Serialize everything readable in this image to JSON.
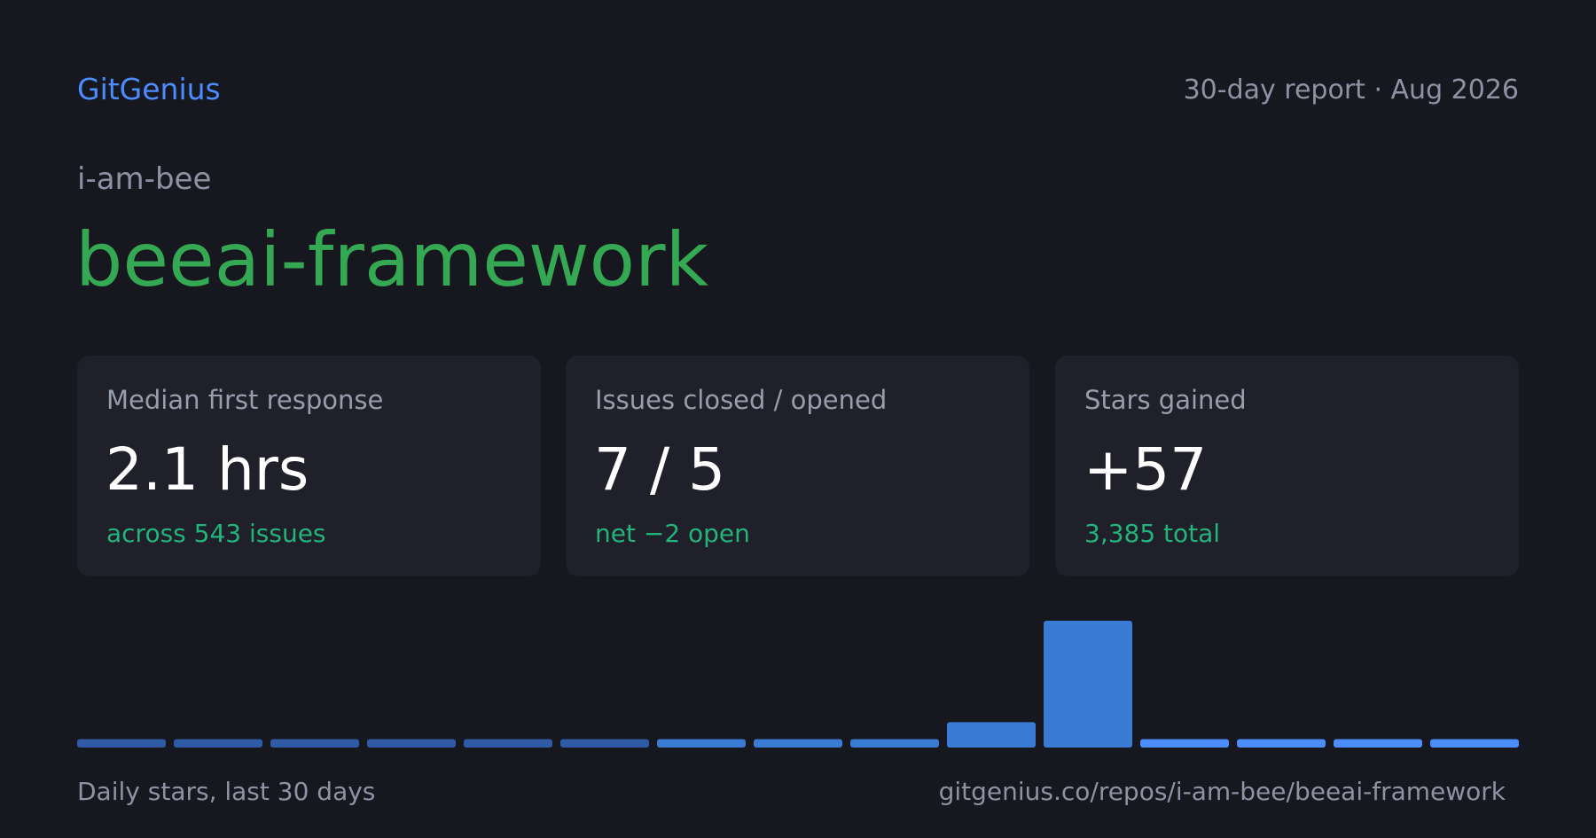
{
  "header": {
    "brand": "GitGenius",
    "report": "30-day report · Aug 2026"
  },
  "repo": {
    "owner": "i-am-bee",
    "name": "beeai-framework"
  },
  "cards": [
    {
      "label": "Median first response",
      "value": "2.1 hrs",
      "sub": "across 543 issues"
    },
    {
      "label": "Issues closed / opened",
      "value": "7 / 5",
      "sub": "net −2 open"
    },
    {
      "label": "Stars gained",
      "value": "+57",
      "sub": "3,385 total"
    }
  ],
  "chart_data": {
    "type": "bar",
    "values": [
      1,
      1,
      1,
      1,
      1,
      1,
      1,
      1,
      1,
      3,
      15,
      1,
      1,
      1,
      1
    ],
    "ylim": [
      0,
      15
    ],
    "color_earlier": "#2f5aa6",
    "color_recent": "#3a7bd5",
    "color_latest": "#4b8dff"
  },
  "footer": {
    "caption": "Daily stars, last 30 days",
    "url": "gitgenius.co/repos/i-am-bee/beeai-framework"
  }
}
